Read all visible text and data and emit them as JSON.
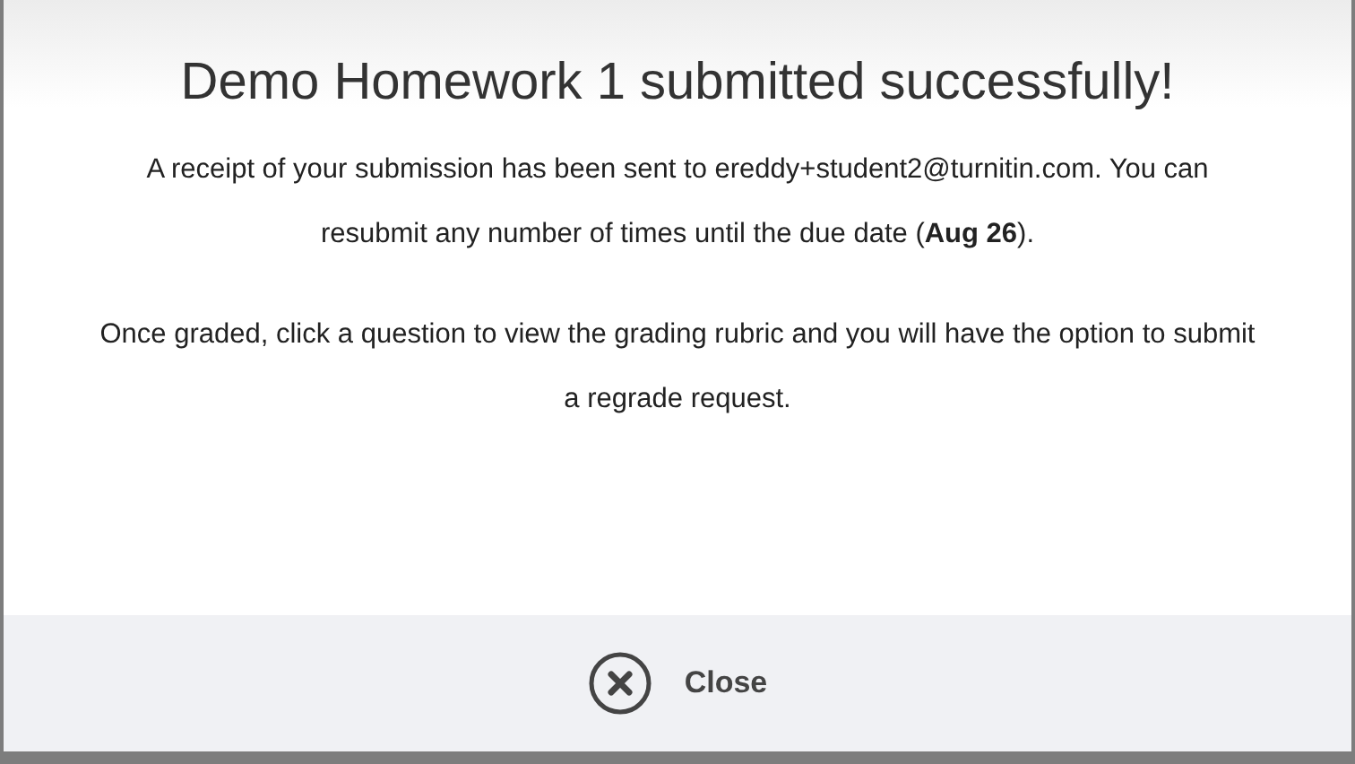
{
  "dialog": {
    "title": "Demo Homework 1 submitted successfully!",
    "paragraphs": [
      "A receipt of your submission has been sent to ereddy+student2@turnitin.com. You can resubmit any number of times until the due date (**Aug 26**).",
      "Once graded, click a question to view the grading rubric and you will have the option to submit a regrade request."
    ],
    "close_button": {
      "label": "Close"
    }
  }
}
